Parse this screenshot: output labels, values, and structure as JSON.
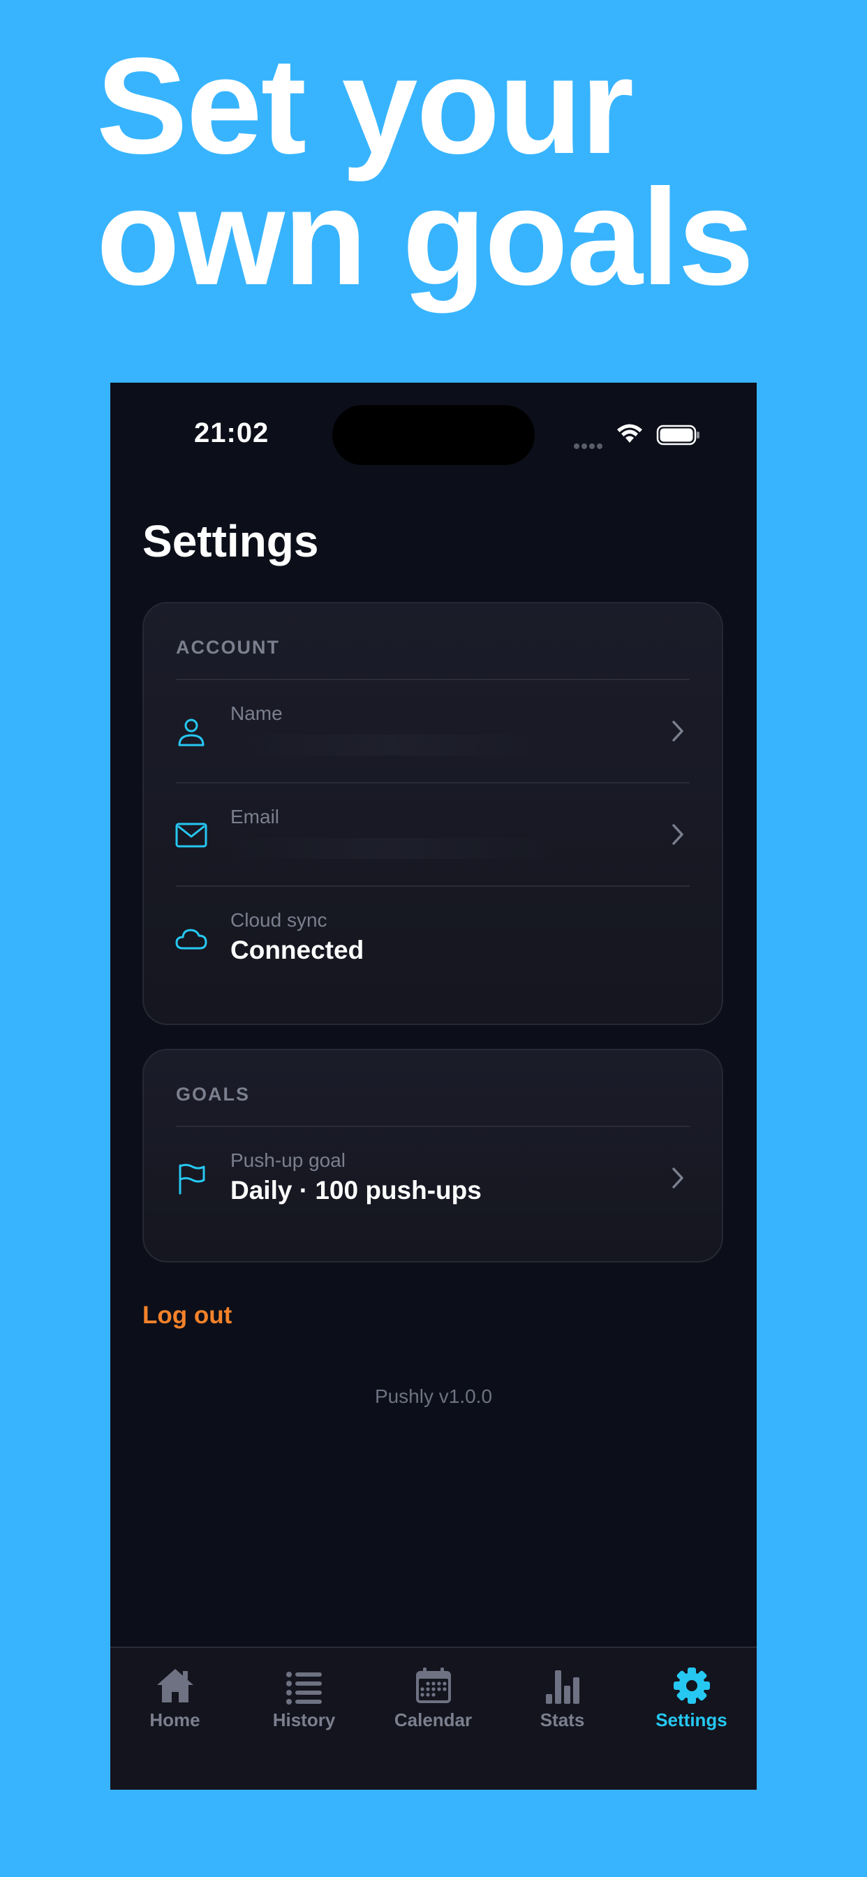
{
  "headline": {
    "line1": "Set your",
    "line2": "own goals"
  },
  "status_bar": {
    "time": "21:02",
    "icons": [
      "signal-icon",
      "wifi-icon",
      "battery-icon"
    ]
  },
  "page": {
    "title": "Settings"
  },
  "account": {
    "header": "ACCOUNT",
    "rows": [
      {
        "label": "Name",
        "value": "",
        "icon": "person-icon"
      },
      {
        "label": "Email",
        "value": "",
        "icon": "mail-icon"
      },
      {
        "label": "Cloud sync",
        "value": "Connected",
        "icon": "cloud-icon"
      }
    ]
  },
  "goals": {
    "header": "GOALS",
    "rows": [
      {
        "label": "Push-up goal",
        "value": "Daily · 100 push-ups",
        "icon": "flag-icon"
      }
    ]
  },
  "actions": {
    "logout": "Log out"
  },
  "footer": {
    "version": "Pushly v1.0.0"
  },
  "tabs": [
    {
      "label": "Home",
      "icon": "home-icon"
    },
    {
      "label": "History",
      "icon": "list-icon"
    },
    {
      "label": "Calendar",
      "icon": "calendar-icon"
    },
    {
      "label": "Stats",
      "icon": "bar-chart-icon"
    },
    {
      "label": "Settings",
      "icon": "gear-icon",
      "active": true
    }
  ],
  "colors": {
    "background": "#38B4FE",
    "screen": "#0C0F19",
    "accent": "#26C8F2",
    "logout": "#F4822A",
    "muted": "#7B7F8E"
  }
}
